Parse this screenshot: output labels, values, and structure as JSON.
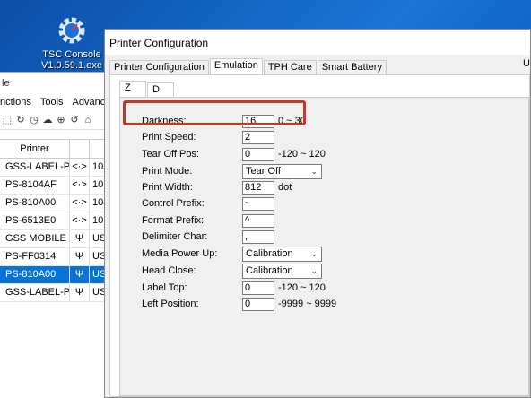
{
  "desktop": {
    "icon_label_line1": "TSC Console",
    "icon_label_line2": "V1.0.59.1.exe",
    "icon_name": "gear-icon"
  },
  "back_window": {
    "title_fragment": "le",
    "menu": [
      "nctions",
      "Tools",
      "Advanced"
    ],
    "column_header": "Printer",
    "rows": [
      {
        "name": "GSS-LABEL-P...",
        "link": "<·>",
        "port": "10"
      },
      {
        "name": "PS-8104AF",
        "link": "<·>",
        "port": "10"
      },
      {
        "name": "PS-810A00",
        "link": "<·>",
        "port": "10"
      },
      {
        "name": "PS-6513E0",
        "link": "<·>",
        "port": "10"
      },
      {
        "name": "GSS MOBILE P...",
        "link": "Ψ",
        "port": "US"
      },
      {
        "name": "PS-FF0314",
        "link": "Ψ",
        "port": "US"
      },
      {
        "name": "PS-810A00",
        "link": "Ψ",
        "port": "US"
      },
      {
        "name": "GSS-LABEL-P...",
        "link": "Ψ",
        "port": "US"
      }
    ],
    "selected_row": 6
  },
  "dialog": {
    "title": "Printer Configuration",
    "tabs": [
      "Printer Configuration",
      "Emulation",
      "TPH Care",
      "Smart Battery"
    ],
    "active_tab": "Emulation",
    "right_cut_label": "U",
    "subtabs": [
      "Z",
      "D"
    ],
    "active_subtab": "Z",
    "fields": {
      "darkness": {
        "label": "Darkness:",
        "value": "16",
        "range": "0 ~ 30"
      },
      "print_speed": {
        "label": "Print Speed:",
        "value": "2"
      },
      "tear_off_pos": {
        "label": "Tear Off Pos:",
        "value": "0",
        "range": "-120 ~ 120"
      },
      "print_mode": {
        "label": "Print Mode:",
        "value": "Tear Off"
      },
      "print_width": {
        "label": "Print Width:",
        "value": "812",
        "range": "dot"
      },
      "control_prefix": {
        "label": "Control Prefix:",
        "value": "~"
      },
      "format_prefix": {
        "label": "Format Prefix:",
        "value": "^"
      },
      "delimiter_char": {
        "label": "Delimiter Char:",
        "value": ","
      },
      "media_power_up": {
        "label": "Media Power Up:",
        "value": "Calibration"
      },
      "head_close": {
        "label": "Head Close:",
        "value": "Calibration"
      },
      "label_top": {
        "label": "Label Top:",
        "value": "0",
        "range": "-120 ~ 120"
      },
      "left_position": {
        "label": "Left Position:",
        "value": "0",
        "range": "-9999 ~ 9999"
      }
    }
  }
}
